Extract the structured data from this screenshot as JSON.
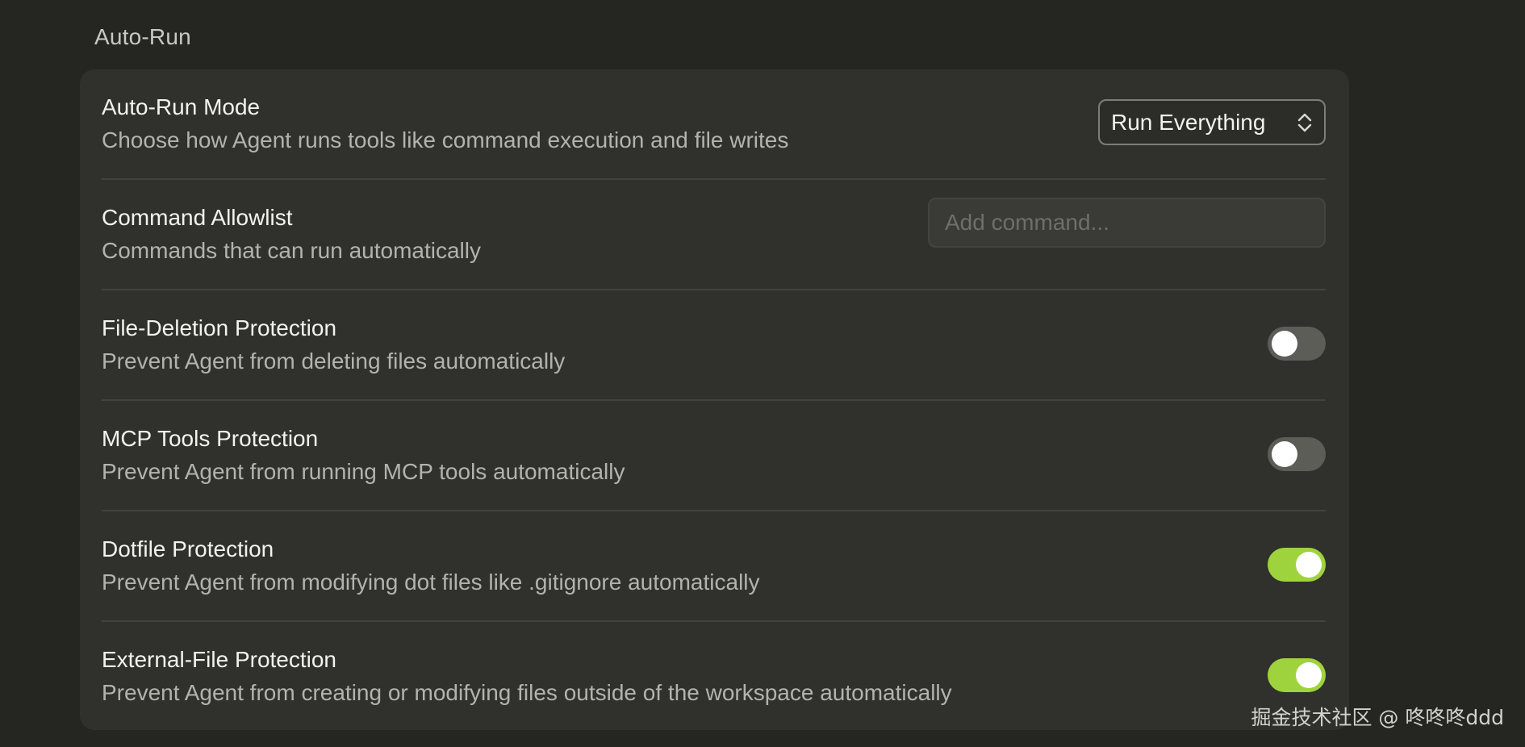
{
  "section": {
    "title": "Auto-Run"
  },
  "rows": [
    {
      "title": "Auto-Run Mode",
      "description": "Choose how Agent runs tools like command execution and file writes",
      "control": "select",
      "value": "Run Everything"
    },
    {
      "title": "Command Allowlist",
      "description": "Commands that can run automatically",
      "control": "input",
      "value": "",
      "placeholder": "Add command..."
    },
    {
      "title": "File-Deletion Protection",
      "description": "Prevent Agent from deleting files automatically",
      "control": "toggle",
      "enabled": false
    },
    {
      "title": "MCP Tools Protection",
      "description": "Prevent Agent from running MCP tools automatically",
      "control": "toggle",
      "enabled": false
    },
    {
      "title": "Dotfile Protection",
      "description": "Prevent Agent from modifying dot files like .gitignore automatically",
      "control": "toggle",
      "enabled": true
    },
    {
      "title": "External-File Protection",
      "description": "Prevent Agent from creating or modifying files outside of the workspace automatically",
      "control": "toggle",
      "enabled": true
    }
  ],
  "colors": {
    "background": "#252622",
    "card": "#30302d",
    "toggle_on": "#9fd33d",
    "toggle_off": "#5d5d58"
  },
  "watermark": "掘金技术社区 @ 咚咚咚ddd"
}
